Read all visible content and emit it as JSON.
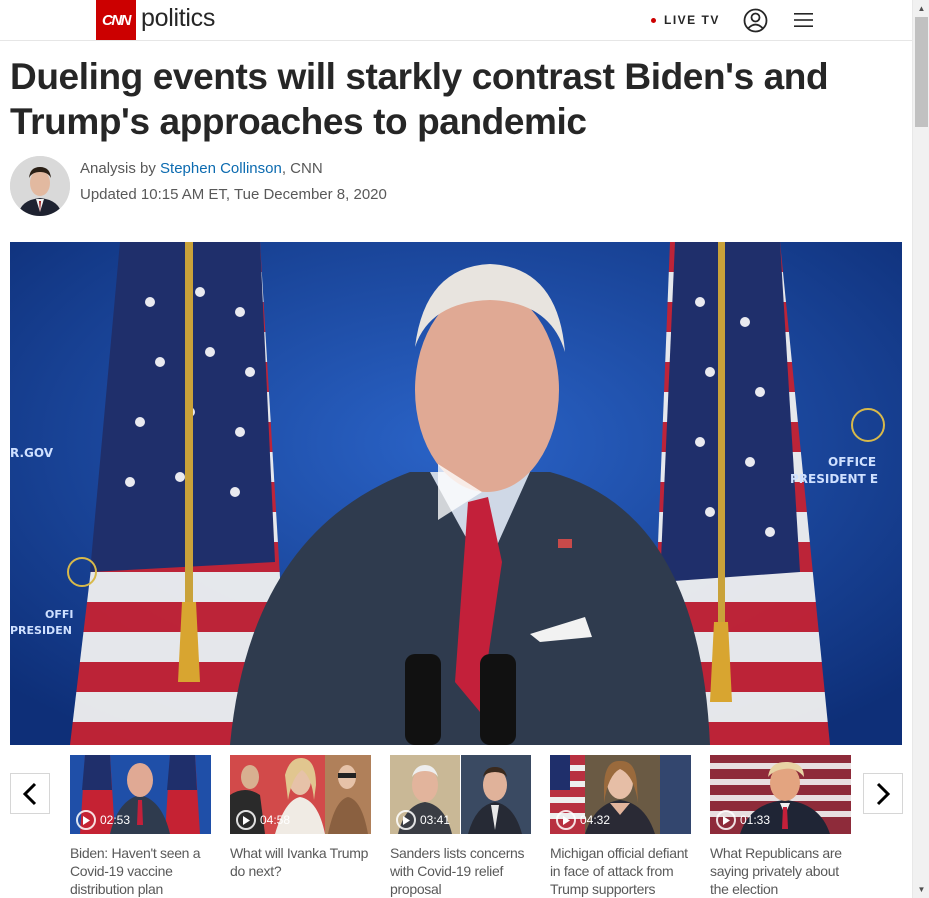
{
  "header": {
    "logo": "CNN",
    "section": "politics",
    "live_label": "LIVE TV",
    "user_icon": "user-icon",
    "menu_icon": "menu-icon"
  },
  "article": {
    "headline": "Dueling events will starkly contrast Biden's and Trump's approaches to pandemic",
    "byline_prefix": "Analysis by",
    "author": "Stephen Collinson",
    "byline_suffix": ", CNN",
    "updated": "Updated 10:15 AM ET, Tue December 8, 2020"
  },
  "video": {
    "play_icon": "play-icon"
  },
  "carousel": {
    "prev_icon": "chevron-left-icon",
    "next_icon": "chevron-right-icon",
    "items": [
      {
        "duration": "02:53",
        "title": "Biden: Haven't seen a Covid-19 vaccine distribution plan"
      },
      {
        "duration": "04:58",
        "title": "What will Ivanka Trump do next?"
      },
      {
        "duration": "03:41",
        "title": "Sanders lists concerns with Covid-19 relief proposal"
      },
      {
        "duration": "04:32",
        "title": "Michigan official defiant in face of attack from Trump supporters"
      },
      {
        "duration": "01:33",
        "title": "What Republicans are saying privately about the election"
      }
    ]
  },
  "colors": {
    "brand_red": "#cc0000",
    "link_blue": "#0c6bb0",
    "text_dark": "#262626",
    "text_muted": "#595959"
  }
}
